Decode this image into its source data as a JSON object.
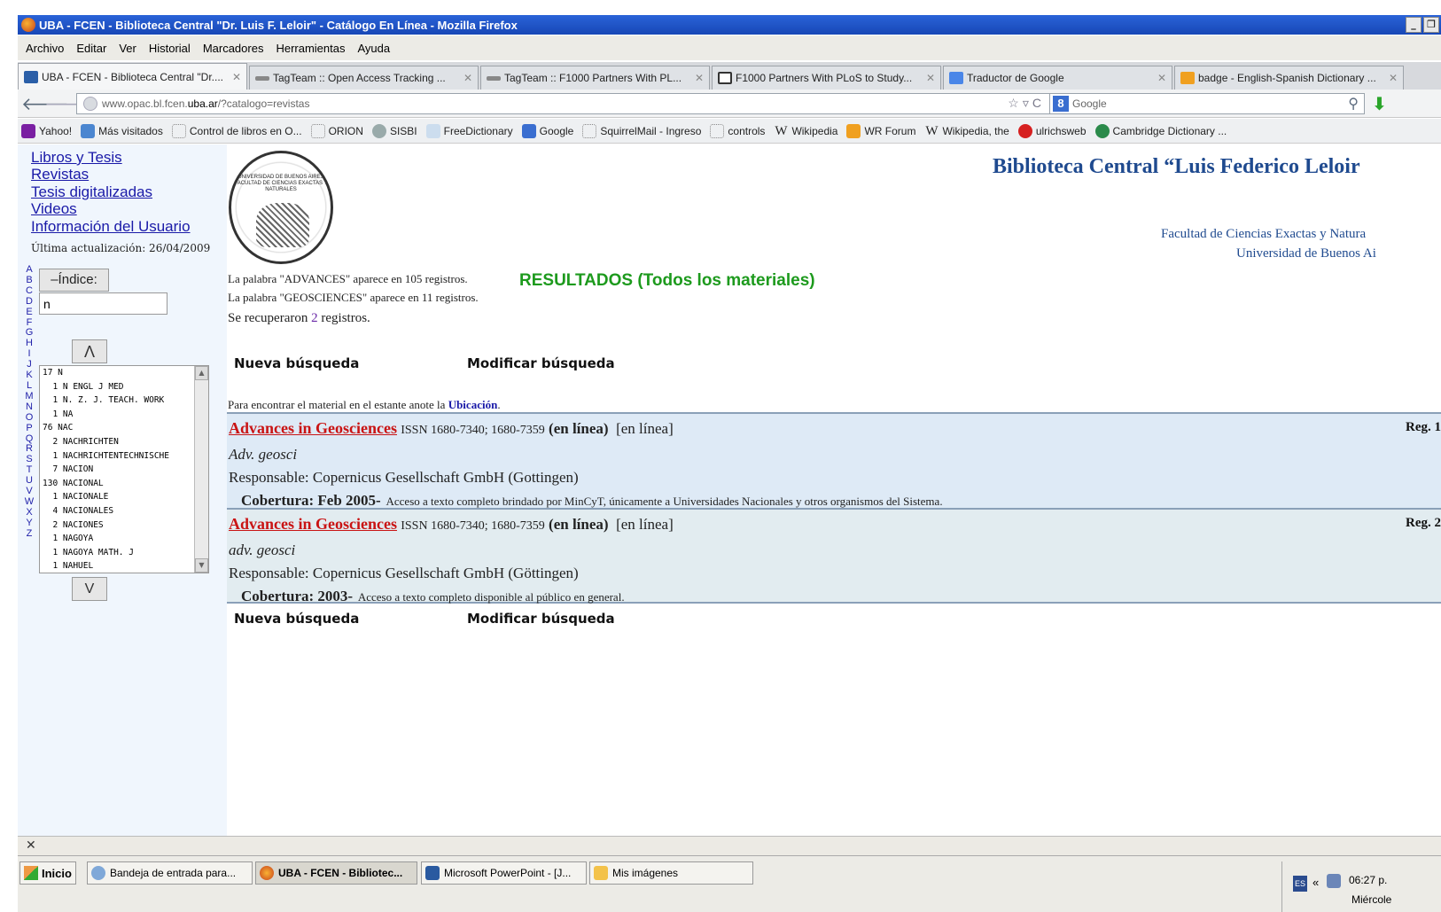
{
  "window": {
    "title": "UBA - FCEN - Biblioteca Central \"Dr. Luis F. Leloir\" - Catálogo En Línea - Mozilla Firefox"
  },
  "menu": [
    "Archivo",
    "Editar",
    "Ver",
    "Historial",
    "Marcadores",
    "Herramientas",
    "Ayuda"
  ],
  "tabs": [
    {
      "label": "UBA - FCEN - Biblioteca Central \"Dr...."
    },
    {
      "label": "TagTeam :: Open Access Tracking ..."
    },
    {
      "label": "TagTeam :: F1000 Partners With PL..."
    },
    {
      "label": "F1000 Partners With PLoS to Study..."
    },
    {
      "label": "Traductor de Google"
    },
    {
      "label": "badge - English-Spanish Dictionary ..."
    }
  ],
  "nav": {
    "url_prefix": "www.opac.bl.fcen.",
    "url_host_bold": "uba.ar",
    "url_suffix": "/?catalogo=revistas",
    "search_placeholder": "Google"
  },
  "bookmarks": [
    "Yahoo!",
    "Más visitados",
    "Control de libros en O...",
    "ORION",
    "SISBI",
    "FreeDictionary",
    "Google",
    "SquirrelMail - Ingreso",
    "controls",
    "Wikipedia",
    "WR Forum",
    "Wikipedia, the",
    "ulrichsweb",
    "Cambridge Dictionary ..."
  ],
  "sidebar": {
    "links": [
      "Libros y Tesis",
      "Revistas",
      "Tesis digitalizadas",
      "Videos",
      "Información del Usuario"
    ],
    "last_update": "Última actualización: 26/04/2009",
    "alphabet": "ABCDEFGHIJKLMNOPQRSTUVWXYZ",
    "indice_label": "–Índice:",
    "indice_value": "n",
    "up_label": "Λ",
    "down_label": "V",
    "index_items": [
      "17 N",
      "  1 N ENGL J MED",
      "  1 N. Z. J. TEACH. WORK",
      "  1 NA",
      "76 NAC",
      "  2 NACHRICHTEN",
      "  1 NACHRICHTENTECHNISCHE",
      "  7 NACION",
      "130 NACIONAL",
      "  1 NACIONALE",
      "  4 NACIONALES",
      "  2 NACIONES",
      "  1 NAGOYA",
      "  1 NAGOYA MATH. J",
      "  1 NAHUEL"
    ]
  },
  "header": {
    "title": "Biblioteca Central “Luis Federico Leloir",
    "faculty": "Facultad de Ciencias Exactas y Natura",
    "university": "Universidad de Buenos Ai",
    "logo_text": "UNIVERSIDAD DE BUENOS AIRES FACULTAD DE CIENCIAS EXACTAS Y NATURALES"
  },
  "results": {
    "word1": "La palabra \"ADVANCES\"     aparece en 105 registros.",
    "heading": "RESULTADOS (Todos los materiales)",
    "word2": "La palabra \"GEOSCIENCES\" aparece en 11 registros.",
    "recup_prefix": "Se recuperaron ",
    "recup_count": "2",
    "recup_suffix": " registros.",
    "nueva": "Nueva búsqueda",
    "modificar": "Modificar búsqueda",
    "encontrar_prefix": "Para encontrar el material en el estante anote la ",
    "encontrar_bold": "Ubicación",
    "encontrar_suffix": "."
  },
  "records": [
    {
      "title": "Advances in Geosciences",
      "issn": "ISSN 1680-7340; 1680-7359",
      "online": "(en línea)",
      "online2": "[en línea]",
      "abbr": "Adv. geosci",
      "resp": "Responsable: Copernicus Gesellschaft GmbH (Gottingen)",
      "cov_label": "Cobertura: Feb 2005-",
      "cov_text": "Acceso a texto completo brindado por MinCyT, únicamente a Universidades Nacionales y otros organismos del Sistema.",
      "reg": "Reg. 1"
    },
    {
      "title": "Advances in Geosciences",
      "issn": "ISSN 1680-7340; 1680-7359",
      "online": "(en línea)",
      "online2": "[en línea]",
      "abbr": "adv. geosci",
      "resp": "Responsable: Copernicus Gesellschaft GmbH (Göttingen)",
      "cov_label": "Cobertura: 2003-",
      "cov_text": "Acceso a texto completo disponible al público en general.",
      "reg": "Reg. 2"
    }
  ],
  "taskbar": {
    "start": "Inicio",
    "items": [
      "Bandeja de entrada para...",
      "UBA - FCEN - Bibliotec...",
      "Microsoft PowerPoint - [J...",
      "Mis imágenes"
    ],
    "lang": "ES",
    "time": "06:27 p.",
    "day": "Miércole"
  }
}
